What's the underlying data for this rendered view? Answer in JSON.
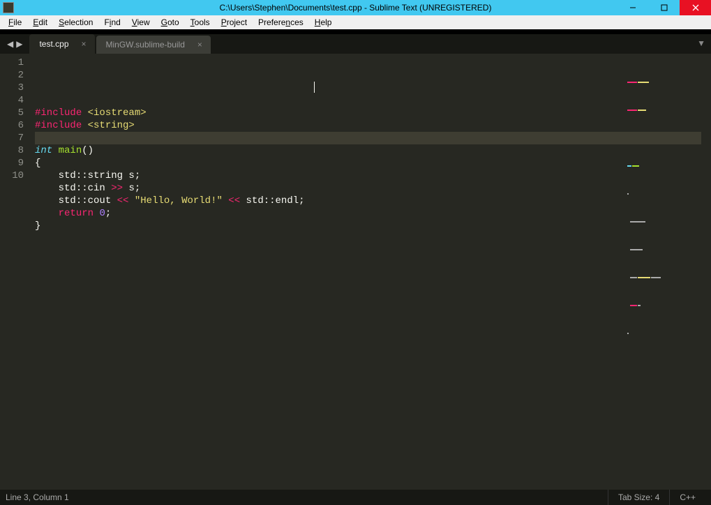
{
  "window": {
    "title": "C:\\Users\\Stephen\\Documents\\test.cpp - Sublime Text (UNREGISTERED)"
  },
  "menu": {
    "items": [
      {
        "label": "File",
        "hotkey": "F"
      },
      {
        "label": "Edit",
        "hotkey": "E"
      },
      {
        "label": "Selection",
        "hotkey": "S"
      },
      {
        "label": "Find",
        "hotkey": "i"
      },
      {
        "label": "View",
        "hotkey": "V"
      },
      {
        "label": "Goto",
        "hotkey": "G"
      },
      {
        "label": "Tools",
        "hotkey": "T"
      },
      {
        "label": "Project",
        "hotkey": "P"
      },
      {
        "label": "Preferences",
        "hotkey": "n"
      },
      {
        "label": "Help",
        "hotkey": "H"
      }
    ]
  },
  "tabs": {
    "items": [
      {
        "label": "test.cpp",
        "active": true
      },
      {
        "label": "MinGW.sublime-build",
        "active": false
      }
    ]
  },
  "editor": {
    "line_numbers": [
      "1",
      "2",
      "3",
      "4",
      "5",
      "6",
      "7",
      "8",
      "9",
      "10"
    ],
    "highlighted_line_index": 2,
    "lines": [
      [
        {
          "t": "#",
          "c": "kw-red"
        },
        {
          "t": "include",
          "c": "kw-red"
        },
        {
          "t": " ",
          "c": "plain"
        },
        {
          "t": "<iostream>",
          "c": "str-yel"
        }
      ],
      [
        {
          "t": "#",
          "c": "kw-red"
        },
        {
          "t": "include",
          "c": "kw-red"
        },
        {
          "t": " ",
          "c": "plain"
        },
        {
          "t": "<string>",
          "c": "str-yel"
        }
      ],
      [],
      [
        {
          "t": "int",
          "c": "ty-blue"
        },
        {
          "t": " ",
          "c": "plain"
        },
        {
          "t": "main",
          "c": "fn-green"
        },
        {
          "t": "()",
          "c": "plain"
        }
      ],
      [
        {
          "t": "{",
          "c": "plain"
        }
      ],
      [
        {
          "t": "    std",
          "c": "plain"
        },
        {
          "t": "::",
          "c": "plain"
        },
        {
          "t": "string s;",
          "c": "plain"
        }
      ],
      [
        {
          "t": "    std",
          "c": "plain"
        },
        {
          "t": "::",
          "c": "plain"
        },
        {
          "t": "cin ",
          "c": "plain"
        },
        {
          "t": ">>",
          "c": "kw-red"
        },
        {
          "t": " s;",
          "c": "plain"
        }
      ],
      [
        {
          "t": "    std",
          "c": "plain"
        },
        {
          "t": "::",
          "c": "plain"
        },
        {
          "t": "cout ",
          "c": "plain"
        },
        {
          "t": "<<",
          "c": "kw-red"
        },
        {
          "t": " ",
          "c": "plain"
        },
        {
          "t": "\"Hello, World!\"",
          "c": "str-yel"
        },
        {
          "t": " ",
          "c": "plain"
        },
        {
          "t": "<<",
          "c": "kw-red"
        },
        {
          "t": " std",
          "c": "plain"
        },
        {
          "t": "::",
          "c": "plain"
        },
        {
          "t": "endl;",
          "c": "plain"
        }
      ],
      [
        {
          "t": "    ",
          "c": "plain"
        },
        {
          "t": "return",
          "c": "kw-red"
        },
        {
          "t": " ",
          "c": "plain"
        },
        {
          "t": "0",
          "c": "num-pur"
        },
        {
          "t": ";",
          "c": "plain"
        }
      ],
      [
        {
          "t": "}",
          "c": "plain"
        }
      ]
    ]
  },
  "status": {
    "position": "Line 3, Column 1",
    "tab_size": "Tab Size: 4",
    "syntax": "C++"
  }
}
